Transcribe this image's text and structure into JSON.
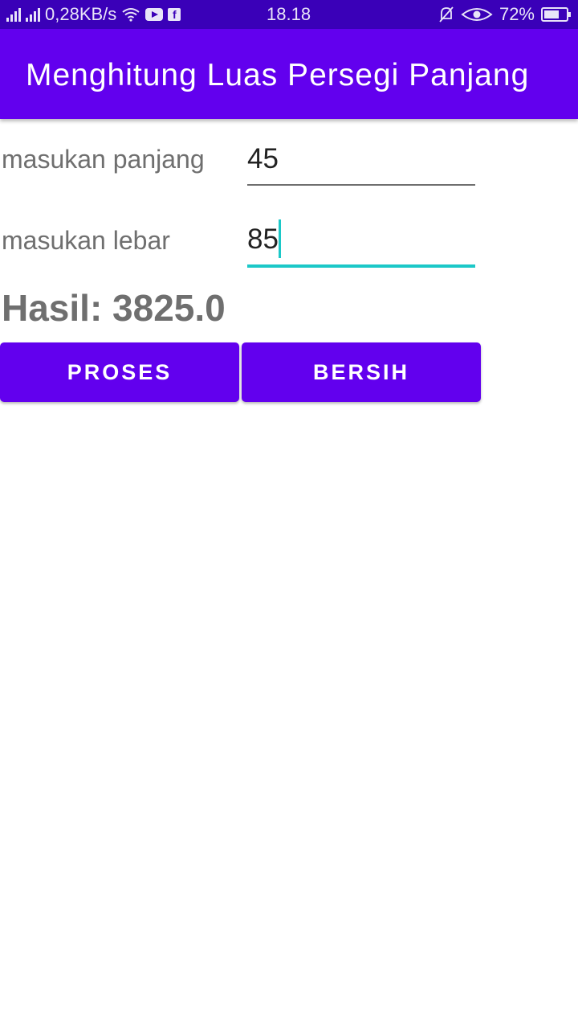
{
  "status_bar": {
    "net_speed": "0,28KB/s",
    "time": "18.18",
    "battery": "72%",
    "icons": [
      "signal-icon",
      "signal-icon",
      "wifi-icon",
      "youtube-icon",
      "facebook-icon",
      "mute-icon",
      "eye-icon",
      "battery-icon"
    ]
  },
  "app_bar": {
    "title": "Menghitung Luas Persegi Panjang"
  },
  "form": {
    "length_label": "masukan panjang",
    "length_value": "45",
    "width_label": "masukan lebar",
    "width_value": "85"
  },
  "result": {
    "text": "Hasil: 3825.0"
  },
  "buttons": {
    "process_label": "PROSES",
    "clear_label": "BERSIH"
  },
  "colors": {
    "primary": "#6200ee",
    "status_bar": "#3a00b8",
    "accent": "#1cc8c8",
    "text_gray": "#6f6f6f"
  }
}
